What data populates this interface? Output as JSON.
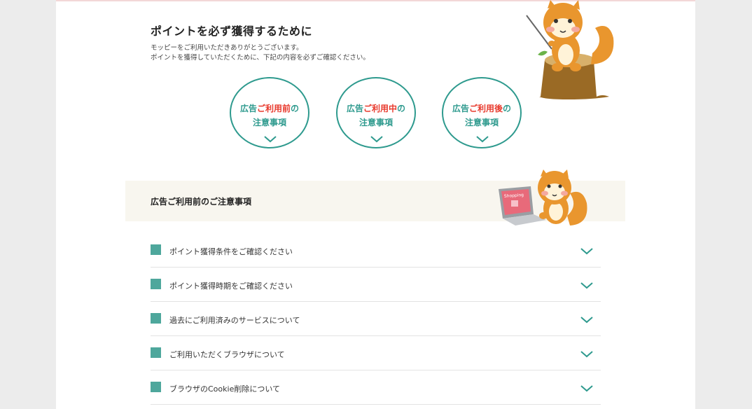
{
  "header": {
    "title": "ポイントを必ず獲得するために",
    "intro_line1": "モッピーをご利用いただきありがとうございます。",
    "intro_line2": "ポイントを獲得していただくために、下記の内容を必ずご確認ください。"
  },
  "circles": [
    {
      "prefix": "広告",
      "highlight": "ご利用前",
      "suffix": "の",
      "line2": "注意事項"
    },
    {
      "prefix": "広告",
      "highlight": "ご利用中",
      "suffix": "の",
      "line2": "注意事項"
    },
    {
      "prefix": "広告",
      "highlight": "ご利用後",
      "suffix": "の",
      "line2": "注意事項"
    }
  ],
  "section": {
    "title": "広告ご利用前のご注意事項",
    "laptop_label": "Shopping"
  },
  "items": [
    {
      "label": "ポイント獲得条件をご確認ください"
    },
    {
      "label": "ポイント獲得時期をご確認ください"
    },
    {
      "label": "過去にご利用済みのサービスについて"
    },
    {
      "label": "ご利用いただくブラウザについて"
    },
    {
      "label": "ブラウザのCookie削除について"
    }
  ],
  "colors": {
    "accent": "#2e9a8e",
    "highlight": "#e8392c",
    "bullet": "#4ea79c",
    "section_bg": "#f8f6ef"
  }
}
